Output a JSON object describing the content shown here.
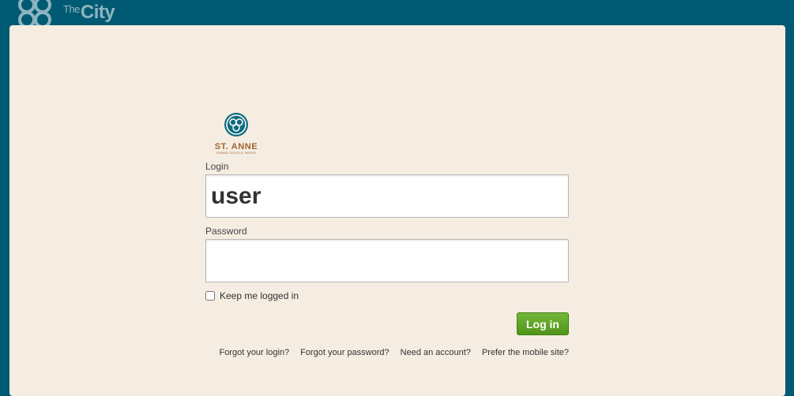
{
  "header": {
    "brand_prefix": "The",
    "brand_name": "City"
  },
  "parish": {
    "name": "ST. ANNE",
    "subtitle": "ROMAN CATHOLIC PARISH"
  },
  "form": {
    "login_label": "Login",
    "login_value": "user",
    "password_label": "Password",
    "password_value": "",
    "remember_label": "Keep me logged in",
    "remember_checked": false,
    "submit_label": "Log in"
  },
  "links": [
    "Forgot your login?",
    "Forgot your password?",
    "Need an account?",
    "Prefer the mobile site?"
  ],
  "colors": {
    "background": "#005a73",
    "panel": "#f5ede2",
    "button": "#5a9f22",
    "parish_accent": "#a26531",
    "parish_logo": "#0e6b7f"
  }
}
